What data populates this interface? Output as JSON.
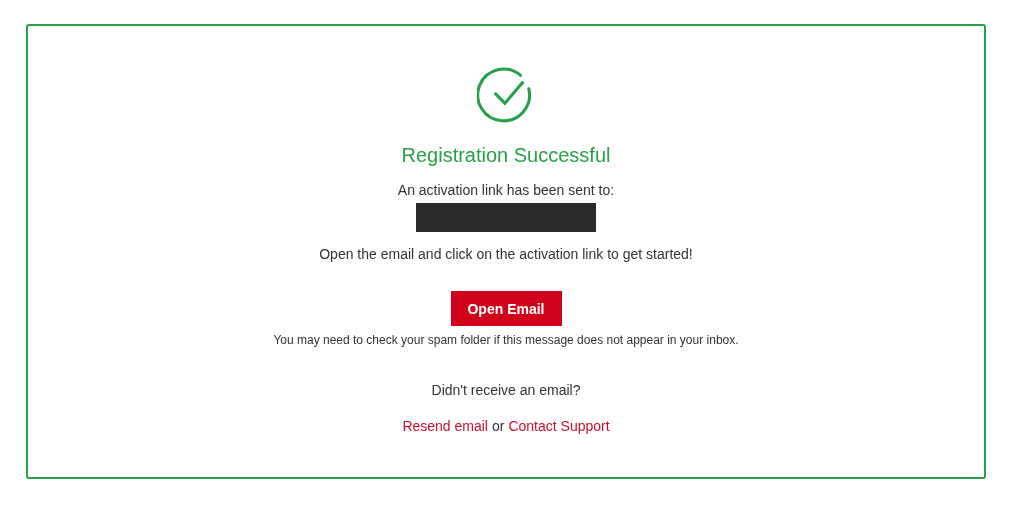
{
  "title": "Registration Successful",
  "sent_to_label": "An activation link has been sent to:",
  "email_redacted": true,
  "instruction": "Open the email and click on the activation link to get started!",
  "open_button": "Open Email",
  "spam_note": "You may need to check your spam folder if this message does not appear in your inbox.",
  "resend_prompt": "Didn't receive an email?",
  "links": [
    {
      "kind": "link",
      "text": "Resend email"
    },
    {
      "kind": "text",
      "text": "or"
    },
    {
      "kind": "link",
      "text": "Contact Support"
    }
  ]
}
